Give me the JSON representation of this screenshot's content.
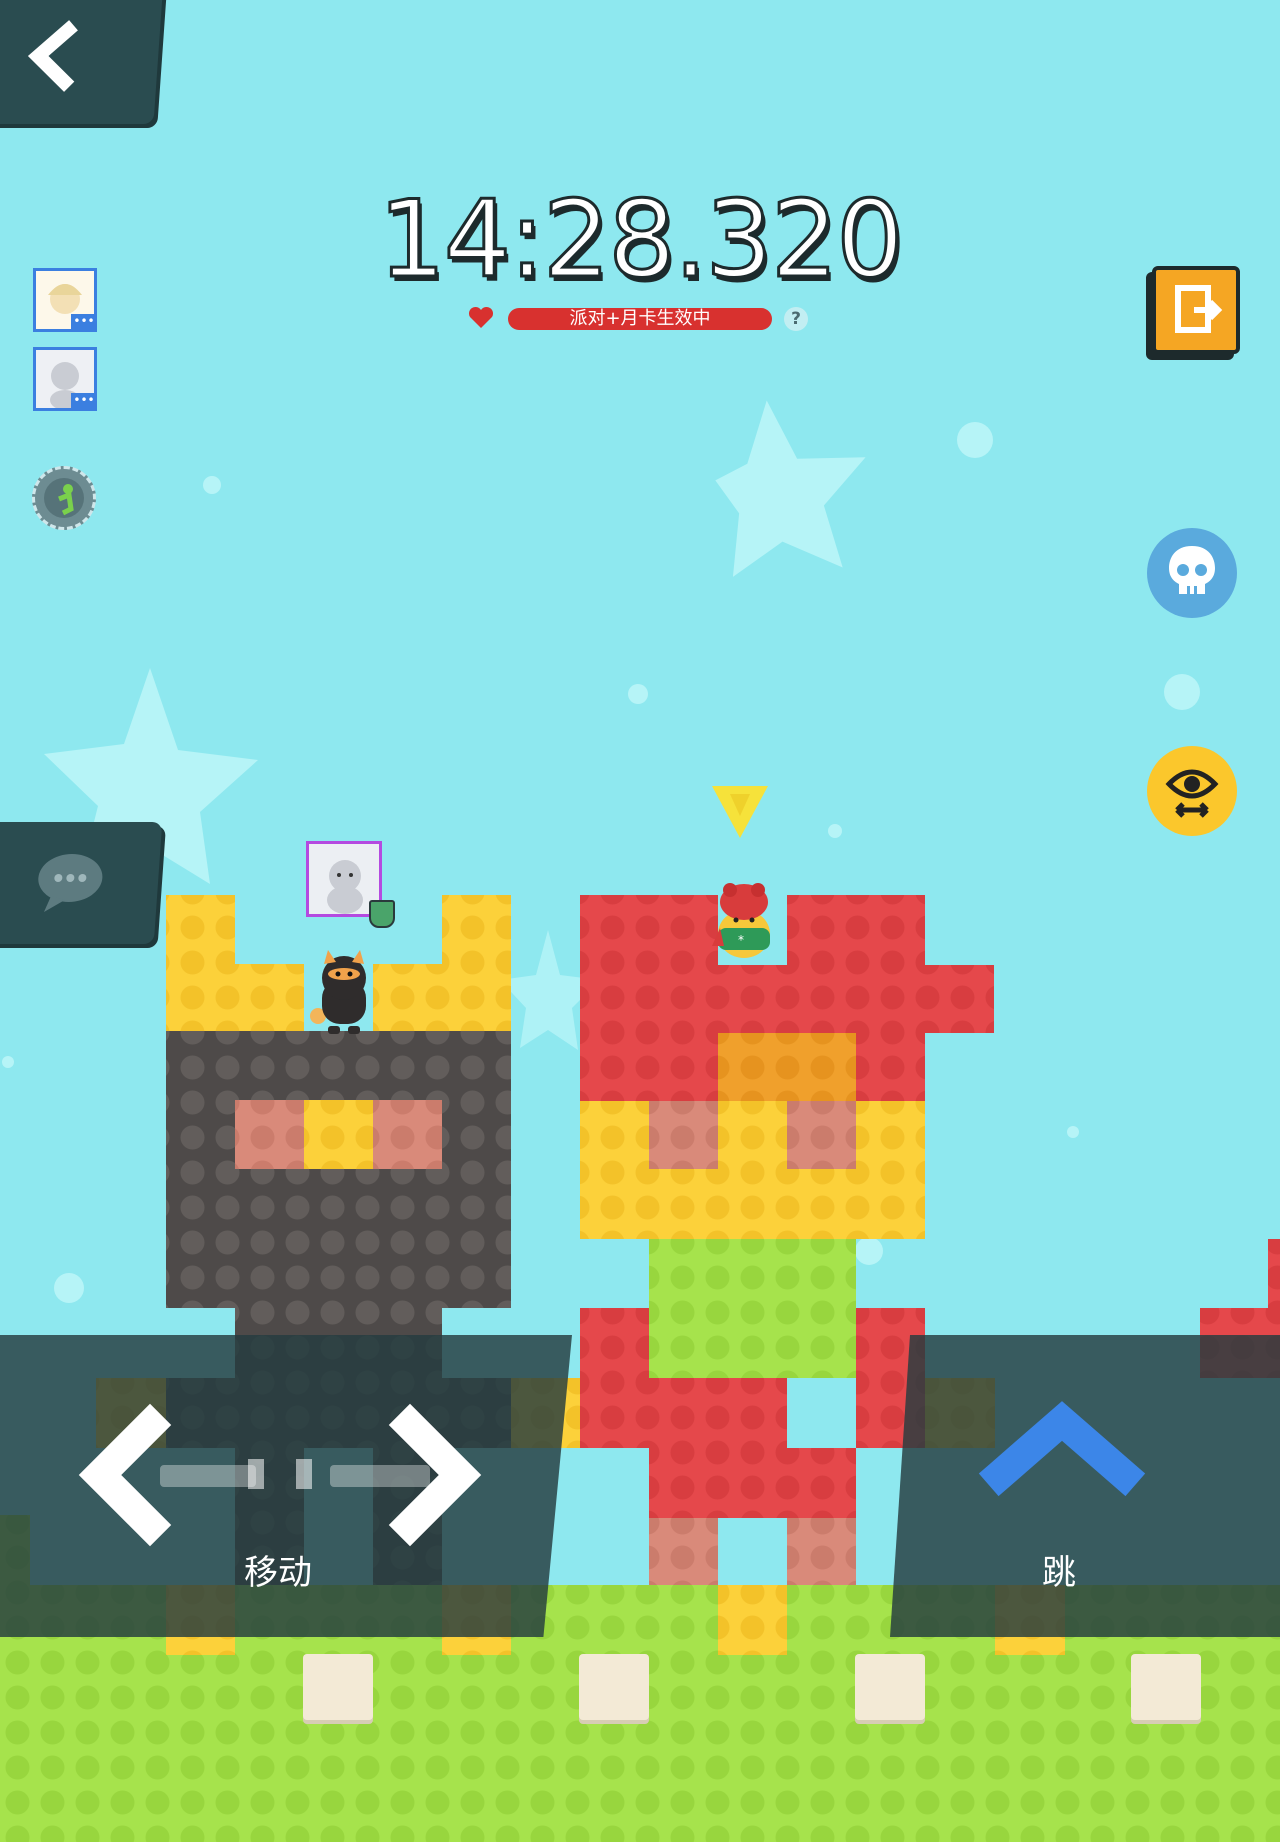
{
  "timer": "14:28.320",
  "status": {
    "party_text": "派对+月卡生效中",
    "help_glyph": "?"
  },
  "controls": {
    "move_label": "移动",
    "jump_label": "跳"
  },
  "colors": {
    "sky": "#8ee8ef",
    "red": "#e5484b",
    "yellow": "#fcd13a",
    "dark": "#4e4a49",
    "green": "#a6e34c",
    "orange": "#f0a02c",
    "accent_blue": "#3b7fe0"
  },
  "icons": {
    "back": "back-chevron-icon",
    "exit": "exit-door-icon",
    "skull": "skull-icon",
    "eye": "view-swap-eye-icon",
    "chat": "chat-bubble-icon",
    "jump": "jump-arrow-icon"
  }
}
